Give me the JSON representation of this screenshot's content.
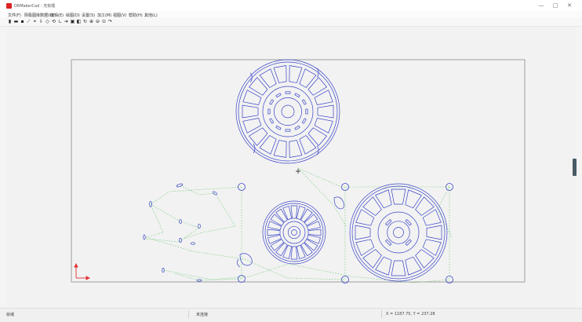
{
  "window": {
    "title": "DRMakerCad - 无标题",
    "controls": {
      "minimize": "—",
      "maximize": "□",
      "close": "✕"
    }
  },
  "menu": [
    "文件(F)",
    "阴极图库数据(C)",
    "编辑(E)",
    "绘图(D)",
    "设置(S)",
    "加工(M)",
    "视图(V)",
    "帮助(H)",
    "其他(L)"
  ],
  "toolbar": [
    {
      "icon": "new-file-icon",
      "glyph": "▮"
    },
    {
      "icon": "open-folder-icon",
      "glyph": "▬"
    },
    {
      "icon": "save-icon",
      "glyph": "▪"
    },
    {
      "icon": "line-tool-icon",
      "glyph": "⟋"
    },
    {
      "icon": "node-edit-icon",
      "glyph": "⌖"
    },
    {
      "icon": "import-icon",
      "glyph": "⇩"
    },
    {
      "icon": "mirror-icon",
      "glyph": "◇"
    },
    {
      "icon": "rotate-icon",
      "glyph": "⟲"
    },
    {
      "icon": "measure-icon",
      "glyph": "∟"
    },
    {
      "icon": "arrow-tool-icon",
      "glyph": "➔"
    },
    {
      "icon": "lock-icon",
      "glyph": "▣"
    },
    {
      "icon": "layer-icon",
      "glyph": "◧"
    },
    {
      "icon": "refresh-icon",
      "glyph": "↻"
    },
    {
      "icon": "zoom-in-icon",
      "glyph": "⊕"
    },
    {
      "icon": "zoom-out-icon",
      "glyph": "⊖"
    },
    {
      "icon": "zoom-fit-icon",
      "glyph": "⊙"
    },
    {
      "icon": "redo-icon",
      "glyph": "↷"
    }
  ],
  "colors": {
    "entity": "#3a46c8",
    "path": "#7fcf86",
    "sheet_border": "#8a8a8a",
    "axis": "#e03030"
  },
  "status": {
    "left": "就绪",
    "middle": "未连接",
    "coords": "X = 1187.75, Y = 237.28"
  }
}
